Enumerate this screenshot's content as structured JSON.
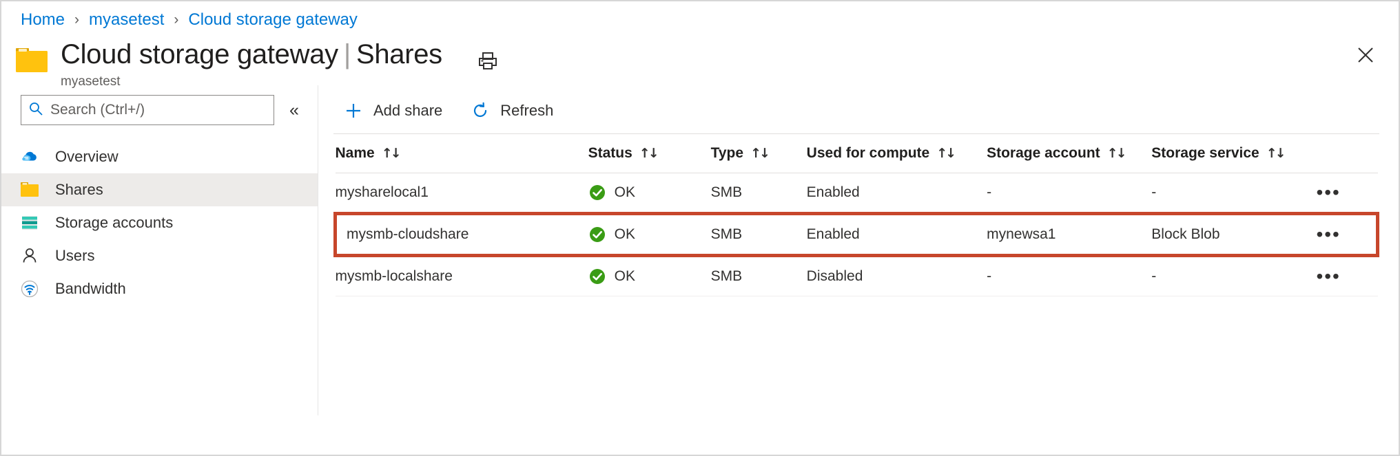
{
  "breadcrumb": {
    "items": [
      {
        "label": "Home"
      },
      {
        "label": "myasetest"
      },
      {
        "label": "Cloud storage gateway"
      }
    ],
    "separator": "›"
  },
  "header": {
    "title": "Cloud storage gateway",
    "title_separator": "|",
    "section": "Shares",
    "subtitle": "myasetest",
    "print_icon": "print-icon",
    "close_icon": "close-icon",
    "folder_icon": "folder-icon"
  },
  "sidebar": {
    "search": {
      "placeholder": "Search (Ctrl+/)",
      "value": "",
      "icon": "search-icon"
    },
    "collapse_icon": "«",
    "items": [
      {
        "label": "Overview",
        "icon": "cloud-icon",
        "selected": false
      },
      {
        "label": "Shares",
        "icon": "folder-icon",
        "selected": true
      },
      {
        "label": "Storage accounts",
        "icon": "storage-account-icon",
        "selected": false
      },
      {
        "label": "Users",
        "icon": "user-icon",
        "selected": false
      },
      {
        "label": "Bandwidth",
        "icon": "bandwidth-icon",
        "selected": false
      }
    ]
  },
  "toolbar": {
    "add_share_label": "Add share",
    "add_share_icon": "plus-icon",
    "refresh_label": "Refresh",
    "refresh_icon": "refresh-icon"
  },
  "table": {
    "sort_icon": "↑↓",
    "menu_icon": "•••",
    "columns": [
      {
        "label": "Name",
        "sortable": true
      },
      {
        "label": "Status",
        "sortable": true
      },
      {
        "label": "Type",
        "sortable": true
      },
      {
        "label": "Used for compute",
        "sortable": true
      },
      {
        "label": "Storage account",
        "sortable": true
      },
      {
        "label": "Storage service",
        "sortable": true
      }
    ],
    "rows": [
      {
        "name": "mysharelocal1",
        "status": "OK",
        "status_icon": "check-circle-icon",
        "type": "SMB",
        "used_for_compute": "Enabled",
        "storage_account": "-",
        "storage_service": "-",
        "highlighted": false
      },
      {
        "name": "mysmb-cloudshare",
        "status": "OK",
        "status_icon": "check-circle-icon",
        "type": "SMB",
        "used_for_compute": "Enabled",
        "storage_account": "mynewsa1",
        "storage_service": "Block Blob",
        "highlighted": true
      },
      {
        "name": "mysmb-localshare",
        "status": "OK",
        "status_icon": "check-circle-icon",
        "type": "SMB",
        "used_for_compute": "Disabled",
        "storage_account": "-",
        "storage_service": "-",
        "highlighted": false
      }
    ]
  },
  "colors": {
    "link": "#0078d4",
    "accent": "#0078d4",
    "status_ok": "#3a9c15",
    "highlight_border": "#c7462b",
    "folder": "#ffb900",
    "selected_row": "#edebe9"
  }
}
